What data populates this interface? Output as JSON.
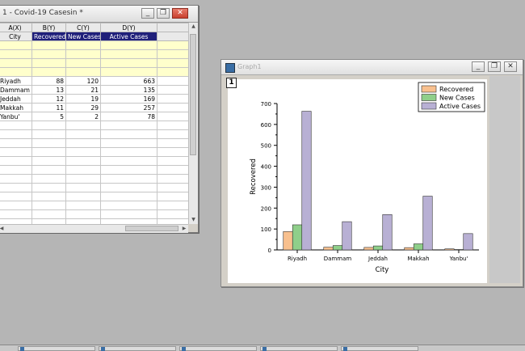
{
  "sheet": {
    "title": "1 - Covid-19 Casesin *",
    "columns": [
      {
        "name": "A(X)",
        "label": "City"
      },
      {
        "name": "B(Y)",
        "label": "Recovered"
      },
      {
        "name": "C(Y)",
        "label": "New Cases"
      },
      {
        "name": "D(Y)",
        "label": "Active Cases"
      }
    ],
    "rows": [
      {
        "city": "Riyadh",
        "recovered": "88",
        "new": "120",
        "active": "663"
      },
      {
        "city": "Dammam",
        "recovered": "13",
        "new": "21",
        "active": "135"
      },
      {
        "city": "Jeddah",
        "recovered": "12",
        "new": "19",
        "active": "169"
      },
      {
        "city": "Makkah",
        "recovered": "11",
        "new": "29",
        "active": "257"
      },
      {
        "city": "Yanbu'",
        "recovered": "5",
        "new": "2",
        "active": "78"
      }
    ],
    "controls": {
      "minimize": "_",
      "restore": "❐",
      "close": "✕"
    }
  },
  "graph": {
    "title": "Graph1",
    "layer": "1",
    "controls": {
      "minimize": "_",
      "restore": "❐",
      "close": "✕"
    }
  },
  "chart_data": {
    "type": "bar",
    "categories": [
      "Riyadh",
      "Dammam",
      "Jeddah",
      "Makkah",
      "Yanbu'"
    ],
    "series": [
      {
        "name": "Recovered",
        "values": [
          88,
          13,
          12,
          11,
          5
        ],
        "color": "#f8c08e"
      },
      {
        "name": "New Cases",
        "values": [
          120,
          21,
          19,
          29,
          2
        ],
        "color": "#8fcf8a"
      },
      {
        "name": "Active Cases",
        "values": [
          663,
          135,
          169,
          257,
          78
        ],
        "color": "#b8b0d4"
      }
    ],
    "xlabel": "City",
    "ylabel": "Recovered",
    "ylim": [
      0,
      700
    ],
    "yticks": [
      "0",
      "100",
      "200",
      "300",
      "400",
      "500",
      "600",
      "700"
    ],
    "legend": "top-right",
    "grid": false
  },
  "taskbar": {
    "items": [
      "",
      "",
      "",
      "",
      "",
      ""
    ]
  }
}
